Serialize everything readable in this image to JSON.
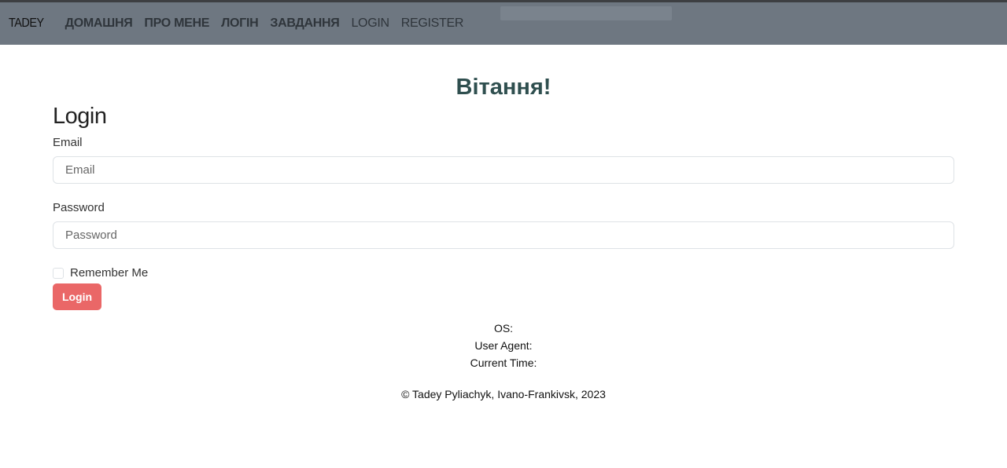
{
  "navbar": {
    "brand": "TADEY",
    "items": [
      {
        "label": "ДОМАШНЯ"
      },
      {
        "label": "ПРО МЕНЕ"
      },
      {
        "label": "ЛОГІН"
      },
      {
        "label": "ЗАВДАННЯ"
      },
      {
        "label": "LOGIN"
      },
      {
        "label": "REGISTER"
      }
    ]
  },
  "greeting": "Вітання!",
  "form": {
    "title": "Login",
    "email_label": "Email",
    "email_placeholder": "Email",
    "password_label": "Password",
    "password_placeholder": "Password",
    "remember_label": "Remember Me",
    "submit_label": "Login"
  },
  "info": {
    "os": "OS:",
    "user_agent": "User Agent:",
    "current_time": "Current Time:"
  },
  "footer": "© Tadey Pyliachyk, Ivano-Frankivsk, 2023"
}
